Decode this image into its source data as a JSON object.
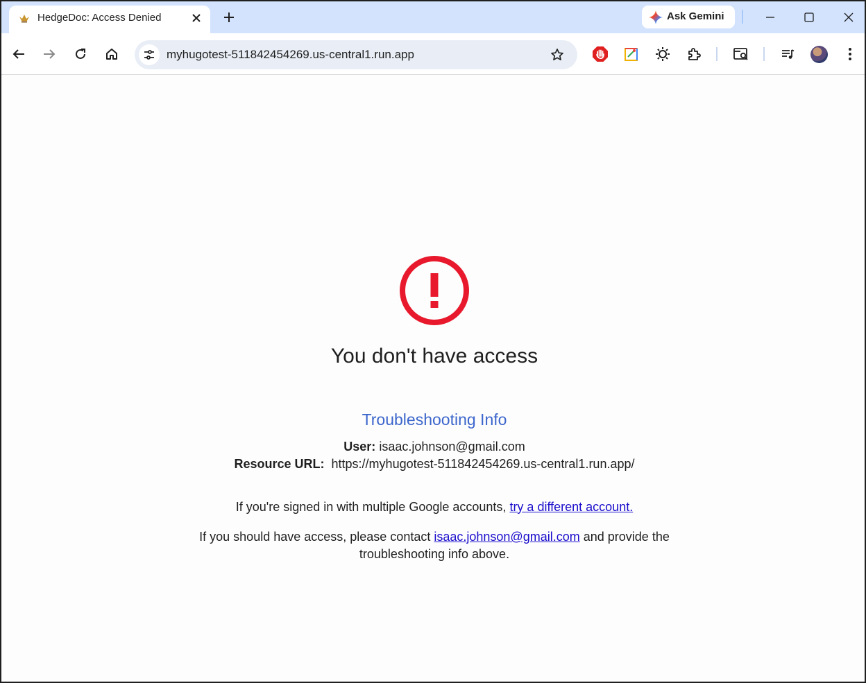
{
  "browser": {
    "tab": {
      "title": "HedgeDoc: Access Denied",
      "favicon": "crown-icon"
    },
    "gemini_label": "Ask Gemini",
    "url": "myhugotest-511842454269.us-central1.run.app",
    "extensions": [
      "stop-sign-icon",
      "color-picker-icon",
      "sun-icon",
      "puzzle-icon",
      "tab-search-icon",
      "media-control-icon"
    ]
  },
  "page": {
    "heading": "You don't have access",
    "troubleshooting_title": "Troubleshooting Info",
    "user_label": "User:",
    "user_value": "isaac.johnson@gmail.com",
    "resource_label": "Resource URL:",
    "resource_value": "https://myhugotest-511842454269.us-central1.run.app/",
    "multi_account_text": "If you're signed in with multiple Google accounts,",
    "multi_account_link": "try a different account.",
    "contact_text_before": "If you should have access, please contact",
    "contact_link": "isaac.johnson@gmail.com",
    "contact_text_after": "and provide the",
    "contact_text_line2": "troubleshooting info above."
  },
  "colors": {
    "alert_red": "#e8192c",
    "link_blue": "#1a0dab",
    "title_blue": "#3c66cc",
    "tabstrip_bg": "#d3e3fd"
  }
}
